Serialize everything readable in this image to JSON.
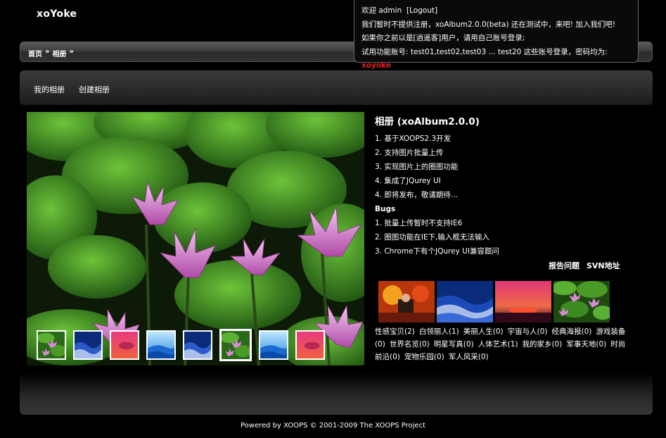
{
  "site": {
    "title": "xoYoke"
  },
  "breadcrumb": {
    "home": "首页",
    "sep1": "»",
    "current": "相册",
    "sep2": "»"
  },
  "notice": {
    "welcome": "欢迎 admin",
    "logout": "[Logout]",
    "line2": "我们暂时不提供注册，xoAlbum2.0.0(beta) 还在测试中，来吧! 加入我们吧!",
    "line3": "如果你之前以是[逍遥客]用户，请用自己账号登录;",
    "line4_prefix": "试用功能账号: test01,test02,test03 ... test20 这些账号登录，密码均为:",
    "password": "xoyoke"
  },
  "nav": {
    "my_albums": "我的相册",
    "create_album": "创建相册"
  },
  "info": {
    "title": "相册 (xoAlbum2.0.0)",
    "features": [
      "1. 基于XOOPS2.3开发",
      "2. 支持图片批量上传",
      "3. 实现图片上的圈图功能",
      "4. 集成了JQurey UI",
      "4. 即将发布，敬请期待..."
    ],
    "bugs_title": "Bugs",
    "bugs": [
      "1. 批量上传暂时不支持IE6",
      "2. 圈图功能在IE下,输入框无法输入",
      "3. Chrome下有个JQurey UI兼容题问"
    ]
  },
  "links": {
    "report": "报告问题",
    "svn": "SVN地址"
  },
  "categories": [
    "性感宝贝(2)",
    "白领丽人(1)",
    "美丽人生(0)",
    "宇宙与人(0)",
    "经典海报(0)",
    "游戏装备(0)",
    "世界名览(0)",
    "明星写真(0)",
    "人体艺术(1)",
    "我的家乡(0)",
    "军事天地(0)",
    "时尚前沿(0)",
    "宠物乐园(0)",
    "军人风采(0)"
  ],
  "thumbnails": [
    "lotus-icon",
    "blue-wave-icon",
    "pink-sunset-icon",
    "blue-mountain-icon",
    "blue-wave-icon",
    "lotus-icon",
    "blue-mountain-icon",
    "pink-sunset-icon"
  ],
  "selected_thumbnail": 6,
  "footer": {
    "text": "Powered by XOOPS © 2001-2009 The XOOPS Project"
  }
}
